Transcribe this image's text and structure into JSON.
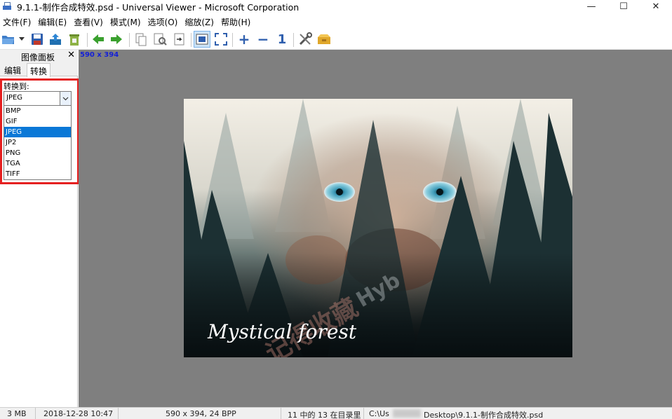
{
  "window": {
    "title": "9.1.1-制作合成特效.psd - Universal Viewer - Microsoft Corporation",
    "minimize": "—",
    "maximize": "☐",
    "close": "✕"
  },
  "menu": [
    "文件(F)",
    "编辑(E)",
    "查看(V)",
    "模式(M)",
    "选项(O)",
    "缩放(Z)",
    "帮助(H)"
  ],
  "toolbar": {
    "icons": [
      "open-folder-icon",
      "dropdown-arrow-icon",
      "save-icon",
      "export-icon",
      "recycle-bin-icon",
      "back-arrow-icon",
      "forward-arrow-icon",
      "copy-icon",
      "print-preview-icon",
      "page-export-icon",
      "fit-window-icon",
      "fullscreen-icon",
      "zoom-in-icon",
      "zoom-out-icon",
      "actual-size-icon",
      "settings-tools-icon",
      "plugin-box-icon"
    ],
    "zoom_in": "+",
    "zoom_out": "−",
    "actual_size": "1"
  },
  "panel": {
    "title": "图像面板",
    "close": "✕",
    "tabs": [
      "编辑",
      "转换"
    ],
    "active_tab": "转换",
    "convert_label": "转换到:",
    "combo_value": "JPEG",
    "options": [
      "BMP",
      "GIF",
      "JPEG",
      "JP2",
      "PNG",
      "TGA",
      "TIFF"
    ],
    "selected_option": "JPEG"
  },
  "canvas": {
    "dimensions": "590 x 394",
    "image_text": "Mystical forest",
    "watermark_cn": "记得收藏",
    "watermark_en": "Hyb",
    "colors": {
      "background": "#7f7f7f",
      "dimension_label": "#1420d6",
      "highlight_box": "#e52020",
      "selected_option": "#0a78d7"
    }
  },
  "status": {
    "size": "3 MB",
    "date": "2018-12-28 10:47",
    "dims": "590 x 394, 24 BPP",
    "position": "11 中的 13 在目录里",
    "path_start": "C:\\Us",
    "path_end": "Desktop\\9.1.1-制作合成特效.psd"
  }
}
